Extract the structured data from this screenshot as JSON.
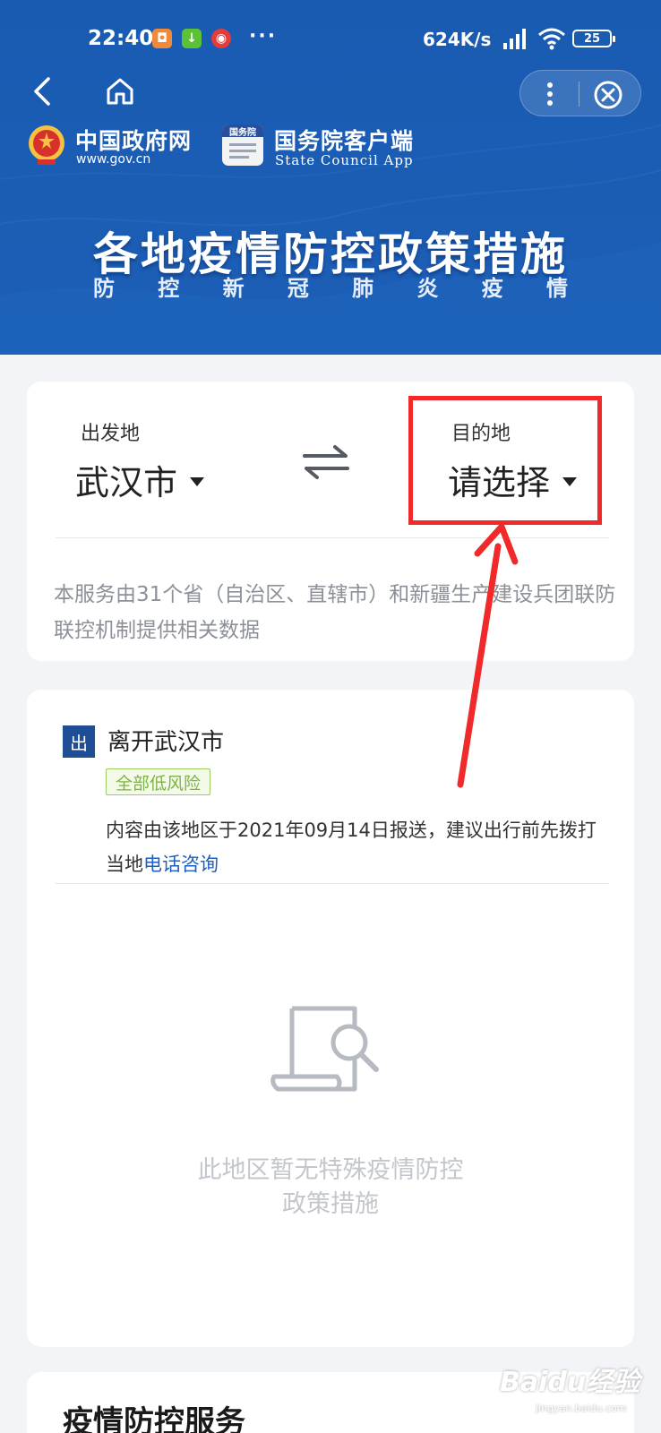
{
  "status_bar": {
    "time": "22:40",
    "network_speed": "624K/s",
    "battery": "25",
    "more": "···"
  },
  "header": {
    "gov_site_name": "中国政府网",
    "gov_site_url": "www.gov.cn",
    "app_logo_text": "国务院",
    "app_name": "国务院客户端",
    "app_name_en": "State Council App",
    "banner_title": "各地疫情防控政策措施",
    "banner_subtitle": [
      "防",
      "控",
      "新",
      "冠",
      "肺",
      "炎",
      "疫",
      "情"
    ]
  },
  "route": {
    "departure_label": "出发地",
    "departure_value": "武汉市",
    "destination_label": "目的地",
    "destination_value": "请选择",
    "note": "本服务由31个省（自治区、直辖市）和新疆生产建设兵团联防联控机制提供相关数据"
  },
  "leave_card": {
    "badge": "出",
    "title": "离开武汉市",
    "risk_tag": "全部低风险",
    "info_text": "内容由该地区于2021年09月14日报送，建议出行前先拨打当地",
    "info_link": "电话咨询",
    "empty_line1": "此地区暂无特殊疫情防控",
    "empty_line2": "政策措施"
  },
  "services": {
    "title": "疫情防控服务"
  },
  "watermark": {
    "main": "Baidu经验",
    "sub": "jingyan.baidu.com"
  },
  "colors": {
    "header_blue": "#1a5bb2",
    "highlight_red": "#f02a2a",
    "risk_green": "#7cb342",
    "link_blue": "#1f5fbf"
  },
  "icons": [
    "back-icon",
    "home-icon",
    "more-icon",
    "close-icon",
    "swap-icon",
    "search-document-icon"
  ]
}
